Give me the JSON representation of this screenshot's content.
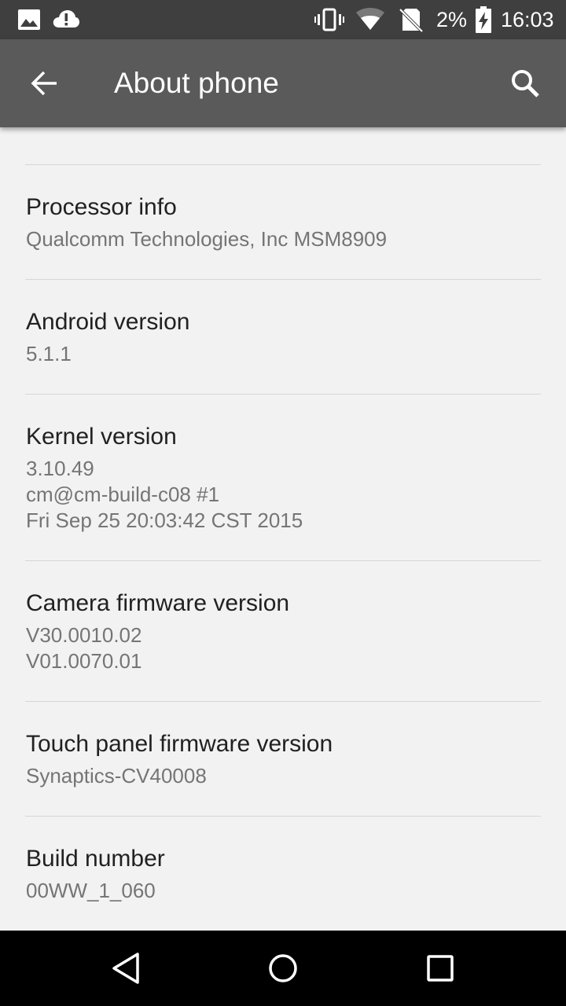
{
  "status_bar": {
    "battery_percent": "2%",
    "time": "16:03",
    "icons": [
      "image-icon",
      "alert-cloud-icon",
      "vibrate-icon",
      "wifi-icon",
      "no-sim-icon",
      "battery-charging-icon"
    ]
  },
  "app_bar": {
    "title": "About phone",
    "back_icon": "arrow-back-icon",
    "search_icon": "search-icon"
  },
  "items": [
    {
      "title": "Processor info",
      "value": "Qualcomm Technologies, Inc MSM8909"
    },
    {
      "title": "Android version",
      "value": "5.1.1"
    },
    {
      "title": "Kernel version",
      "value": "3.10.49\ncm@cm-build-c08 #1\nFri Sep 25 20:03:42 CST 2015"
    },
    {
      "title": "Camera firmware version",
      "value": "V30.0010.02\nV01.0070.01"
    },
    {
      "title": "Touch panel firmware version",
      "value": "Synaptics-CV40008"
    },
    {
      "title": "Build number",
      "value": "00WW_1_060"
    }
  ],
  "nav_bar": {
    "back": "nav-back-icon",
    "home": "nav-home-icon",
    "recents": "nav-recents-icon"
  },
  "colors": {
    "status_bar_bg": "#3f3f3f",
    "app_bar_bg": "#5a5a5a",
    "background": "#f2f2f2",
    "title_text": "#212121",
    "secondary_text": "#757575",
    "divider": "#d6d6d6",
    "nav_bar_bg": "#000000"
  }
}
